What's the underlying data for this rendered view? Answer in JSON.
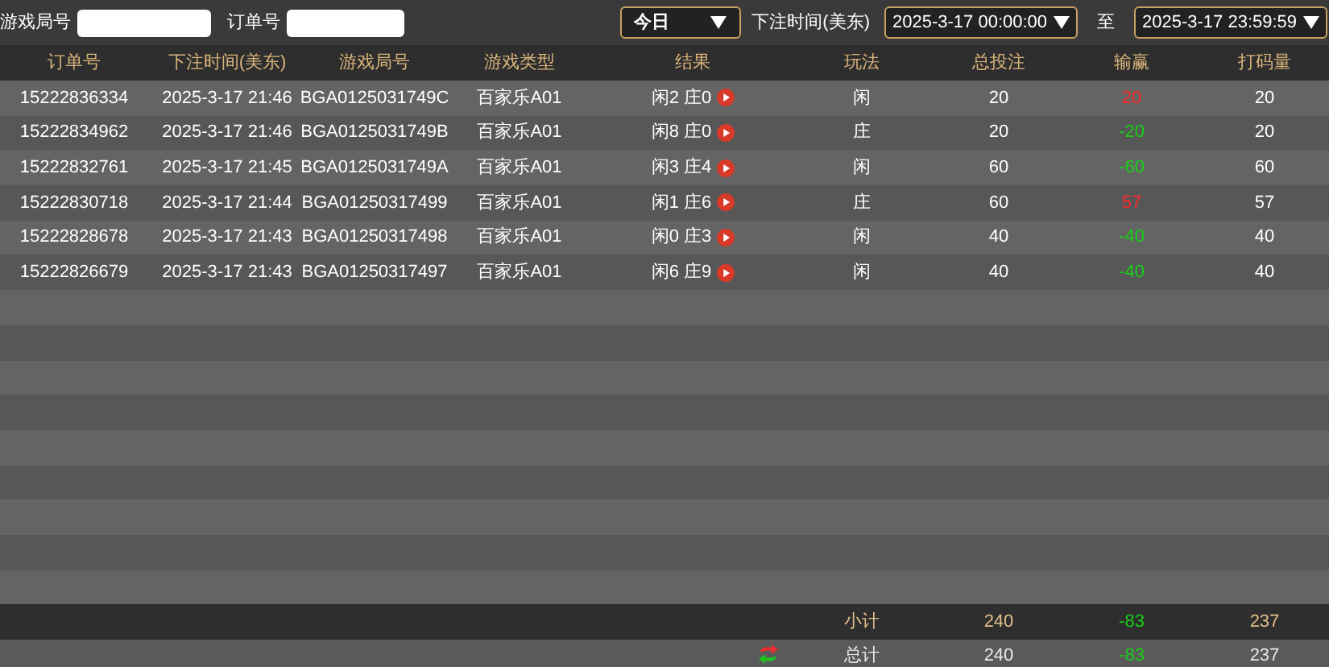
{
  "filters": {
    "round_label": "游戏局号",
    "order_label": "订单号",
    "period": "今日",
    "time_label": "下注时间(美东)",
    "start": "2025-3-17 00:00:00",
    "to_label": "至",
    "end": "2025-3-17 23:59:59"
  },
  "columns": [
    "订单号",
    "下注时间(美东)",
    "游戏局号",
    "游戏类型",
    "结果",
    "玩法",
    "总投注",
    "输赢",
    "打码量"
  ],
  "rows": [
    {
      "order": "15222836334",
      "time": "2025-3-17 21:46",
      "round": "BGA0125031749C",
      "game": "百家乐A01",
      "result": "闲2 庄0",
      "bet": "闲",
      "total": "20",
      "winloss": "20",
      "color": "#ff2a2a",
      "volume": "20"
    },
    {
      "order": "15222834962",
      "time": "2025-3-17 21:46",
      "round": "BGA0125031749B",
      "game": "百家乐A01",
      "result": "闲8 庄0",
      "bet": "庄",
      "total": "20",
      "winloss": "-20",
      "color": "#16d016",
      "volume": "20"
    },
    {
      "order": "15222832761",
      "time": "2025-3-17 21:45",
      "round": "BGA0125031749A",
      "game": "百家乐A01",
      "result": "闲3 庄4",
      "bet": "闲",
      "total": "60",
      "winloss": "-60",
      "color": "#16d016",
      "volume": "60"
    },
    {
      "order": "15222830718",
      "time": "2025-3-17 21:44",
      "round": "BGA01250317499",
      "game": "百家乐A01",
      "result": "闲1 庄6",
      "bet": "庄",
      "total": "60",
      "winloss": "57",
      "color": "#ff2a2a",
      "volume": "57"
    },
    {
      "order": "15222828678",
      "time": "2025-3-17 21:43",
      "round": "BGA01250317498",
      "game": "百家乐A01",
      "result": "闲0 庄3",
      "bet": "闲",
      "total": "40",
      "winloss": "-40",
      "color": "#16d016",
      "volume": "40"
    },
    {
      "order": "15222826679",
      "time": "2025-3-17 21:43",
      "round": "BGA01250317497",
      "game": "百家乐A01",
      "result": "闲6 庄9",
      "bet": "闲",
      "total": "40",
      "winloss": "-40",
      "color": "#16d016",
      "volume": "40"
    }
  ],
  "subtotal": {
    "label": "小计",
    "total": "240",
    "winloss": "-83",
    "volume": "237"
  },
  "grand_total": {
    "label": "总计",
    "total": "240",
    "winloss": "-83",
    "volume": "237"
  }
}
